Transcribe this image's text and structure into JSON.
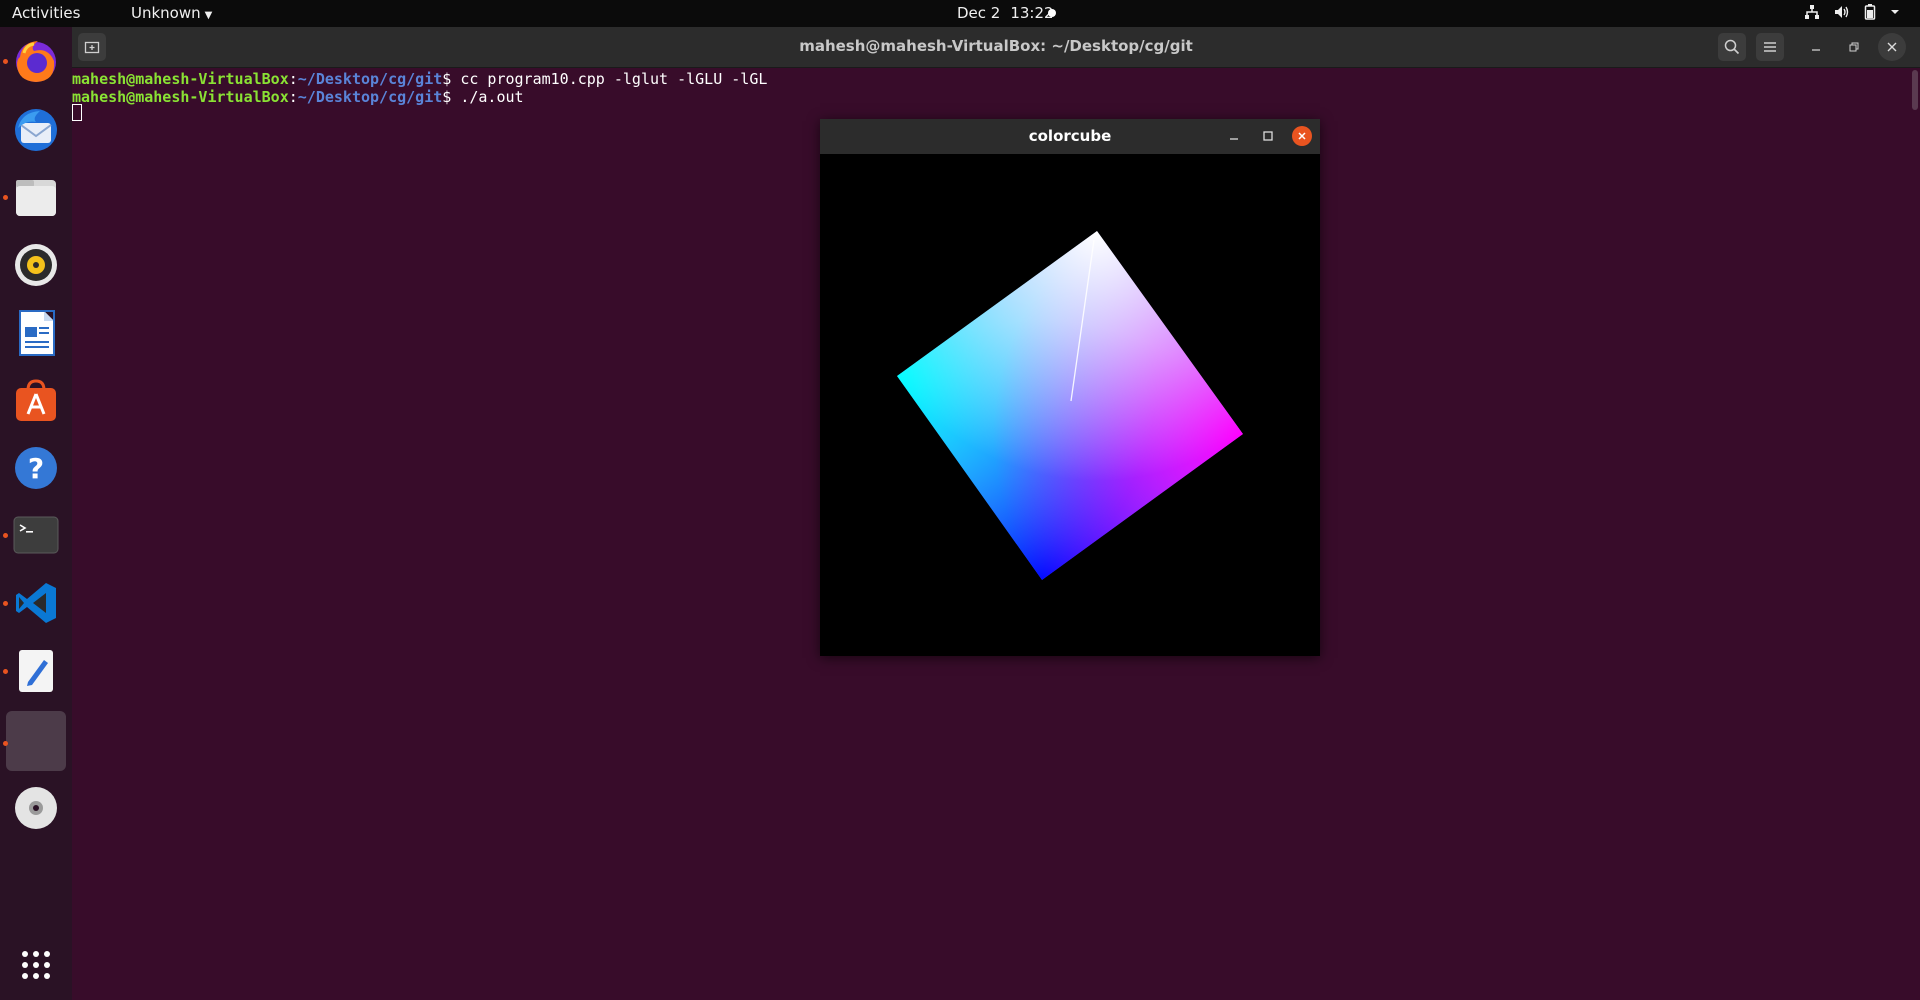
{
  "topbar": {
    "activities": "Activities",
    "app_menu": "Unknown",
    "date": "Dec 2",
    "time": "13:22"
  },
  "dock": {
    "items": [
      {
        "name": "firefox",
        "running": true
      },
      {
        "name": "thunderbird",
        "running": false
      },
      {
        "name": "files",
        "running": true
      },
      {
        "name": "rhythmbox",
        "running": false
      },
      {
        "name": "libreoffice-writer",
        "running": false
      },
      {
        "name": "ubuntu-software",
        "running": false
      },
      {
        "name": "help",
        "running": false
      },
      {
        "name": "terminal",
        "running": true
      },
      {
        "name": "vscode",
        "running": true
      },
      {
        "name": "text-editor",
        "running": true
      },
      {
        "name": "colorcube-app",
        "running": true,
        "active": true
      },
      {
        "name": "dvd-drive",
        "running": false
      }
    ],
    "show_apps": "apps-grid"
  },
  "terminal": {
    "title": "mahesh@mahesh-VirtualBox: ~/Desktop/cg/git",
    "lines": [
      {
        "user": "mahesh@mahesh-VirtualBox",
        "sep": ":",
        "path": "~/Desktop/cg/git",
        "prompt": "$ ",
        "cmd": "cc program10.cpp -lglut -lGLU -lGL"
      },
      {
        "user": "mahesh@mahesh-VirtualBox",
        "sep": ":",
        "path": "~/Desktop/cg/git",
        "prompt": "$ ",
        "cmd": "./a.out"
      }
    ]
  },
  "colorcube_window": {
    "title": "colorcube"
  },
  "colors": {
    "accent": "#e95420",
    "terminal_bg": "#380c2a",
    "user_green": "#8ae234",
    "path_blue": "#5a84d8"
  }
}
